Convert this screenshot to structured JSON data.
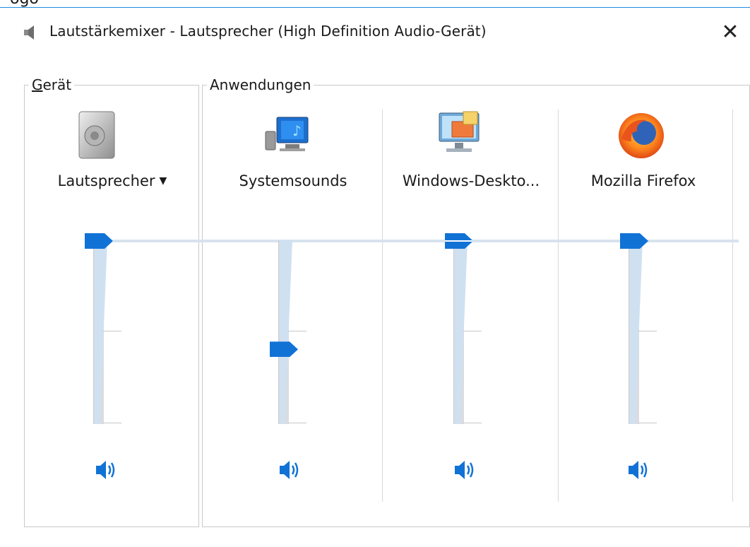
{
  "top_strip_text": "ogo",
  "window": {
    "title": "Lautstärkemixer - Lautsprecher (High Definition Audio-Gerät)",
    "title_icon": "speaker-icon",
    "close_label": "✕"
  },
  "device_group": {
    "legend_accel": "G",
    "legend_rest": "erät",
    "device": {
      "label": "Lautsprecher",
      "dropdown_arrow": "▼",
      "icon": "speaker-device-icon",
      "volume_fraction": 1.0,
      "mute_icon": "volume-icon"
    }
  },
  "apps_group": {
    "legend": "Anwendungen",
    "apps": [
      {
        "label": "Systemsounds",
        "icon": "system-sounds-icon",
        "volume_fraction": 0.41,
        "mute_icon": "volume-icon"
      },
      {
        "label": "Windows-Deskto...",
        "icon": "windows-desktop-icon",
        "volume_fraction": 1.0,
        "mute_icon": "volume-icon"
      },
      {
        "label": "Mozilla Firefox",
        "icon": "firefox-icon",
        "volume_fraction": 1.0,
        "mute_icon": "volume-icon"
      }
    ]
  },
  "colors": {
    "accent": "#1172d6",
    "track": "#d9dde2",
    "border": "#c9c9c9"
  }
}
